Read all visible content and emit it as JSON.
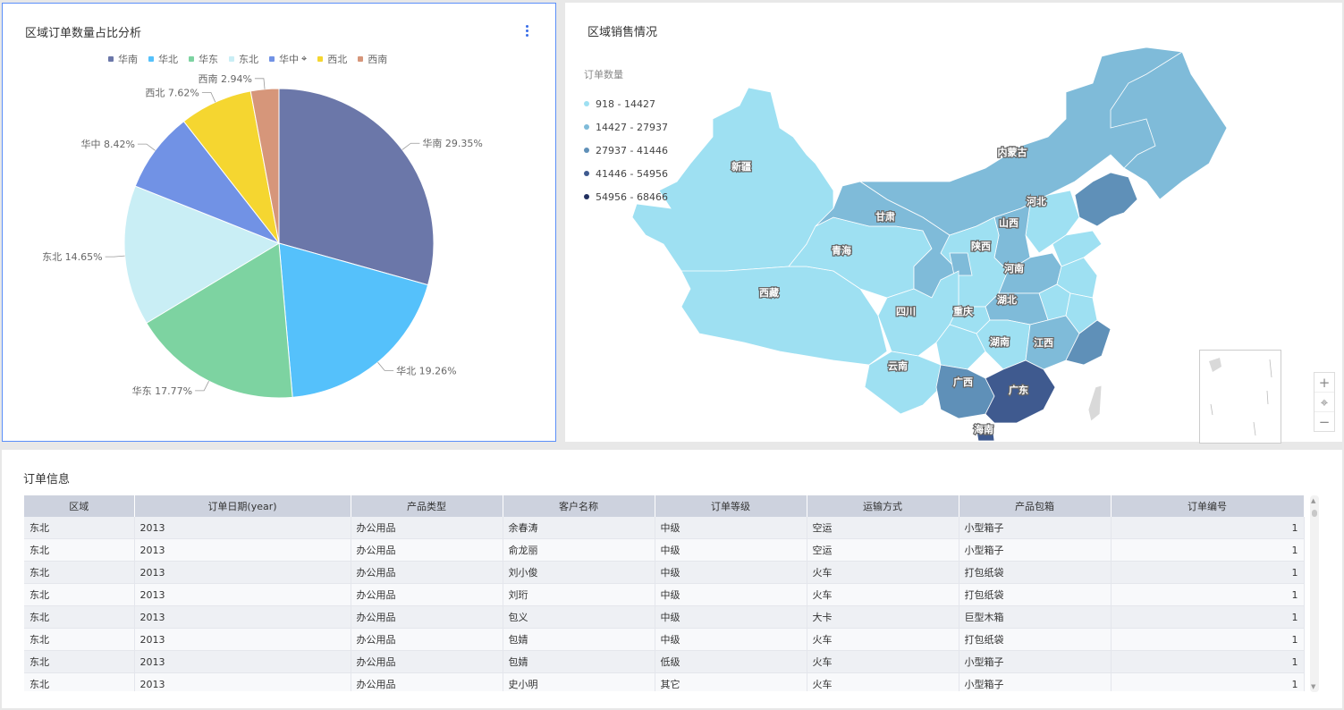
{
  "pie_panel": {
    "title": "区域订单数量占比分析",
    "legend": [
      {
        "label": "华南",
        "color": "#6b77a9"
      },
      {
        "label": "华北",
        "color": "#55c1fb"
      },
      {
        "label": "华东",
        "color": "#7dd3a1"
      },
      {
        "label": "东北",
        "color": "#c9eef5"
      },
      {
        "label": "华中",
        "color": "#7192e5"
      },
      {
        "label": "西北",
        "color": "#f5d630"
      },
      {
        "label": "西南",
        "color": "#d6967a"
      }
    ]
  },
  "chart_data": {
    "type": "pie",
    "slices": [
      {
        "name": "华南",
        "value": 29.35,
        "label": "华南 29.35%",
        "color": "#6b77a9"
      },
      {
        "name": "华北",
        "value": 19.26,
        "label": "华北 19.26%",
        "color": "#55c1fb"
      },
      {
        "name": "华东",
        "value": 17.77,
        "label": "华东 17.77%",
        "color": "#7dd3a1"
      },
      {
        "name": "东北",
        "value": 14.65,
        "label": "东北 14.65%",
        "color": "#c9eef5"
      },
      {
        "name": "华中",
        "value": 8.42,
        "label": "华中 8.42%",
        "color": "#7192e5"
      },
      {
        "name": "西北",
        "value": 7.62,
        "label": "西北 7.62%",
        "color": "#f5d630"
      },
      {
        "name": "西南",
        "value": 2.94,
        "label": "西南 2.94%",
        "color": "#d6967a"
      }
    ]
  },
  "map_panel": {
    "title": "区域销售情况",
    "legend_title": "订单数量",
    "legend": [
      {
        "label": "918 - 14427",
        "color": "#9ee0f2"
      },
      {
        "label": "14427 - 27937",
        "color": "#7fbbd9"
      },
      {
        "label": "27937 - 41446",
        "color": "#5f90b8"
      },
      {
        "label": "41446 - 54956",
        "color": "#3f5a8f"
      },
      {
        "label": "54956 - 68466",
        "color": "#223060"
      }
    ],
    "provinces": [
      "新疆",
      "内蒙古",
      "甘肃",
      "青海",
      "西藏",
      "河北",
      "山西",
      "陕西",
      "河南",
      "湖北",
      "四川",
      "重庆",
      "湖南",
      "江西",
      "云南",
      "广西",
      "广东",
      "海南"
    ],
    "controls": {
      "zoom_in": "+",
      "locate": "⌖",
      "zoom_out": "−"
    }
  },
  "table_panel": {
    "title": "订单信息",
    "columns": [
      "区域",
      "订单日期(year)",
      "产品类型",
      "客户名称",
      "订单等级",
      "运输方式",
      "产品包箱",
      "订单编号"
    ],
    "rows": [
      [
        "东北",
        "2013",
        "办公用品",
        "余春涛",
        "中级",
        "空运",
        "小型箱子",
        "1"
      ],
      [
        "东北",
        "2013",
        "办公用品",
        "俞龙丽",
        "中级",
        "空运",
        "小型箱子",
        "1"
      ],
      [
        "东北",
        "2013",
        "办公用品",
        "刘小俊",
        "中级",
        "火车",
        "打包纸袋",
        "1"
      ],
      [
        "东北",
        "2013",
        "办公用品",
        "刘珩",
        "中级",
        "火车",
        "打包纸袋",
        "1"
      ],
      [
        "东北",
        "2013",
        "办公用品",
        "包义",
        "中级",
        "大卡",
        "巨型木箱",
        "1"
      ],
      [
        "东北",
        "2013",
        "办公用品",
        "包婧",
        "中级",
        "火车",
        "打包纸袋",
        "1"
      ],
      [
        "东北",
        "2013",
        "办公用品",
        "包婧",
        "低级",
        "火车",
        "小型箱子",
        "1"
      ],
      [
        "东北",
        "2013",
        "办公用品",
        "史小明",
        "其它",
        "火车",
        "小型箱子",
        "1"
      ]
    ]
  }
}
